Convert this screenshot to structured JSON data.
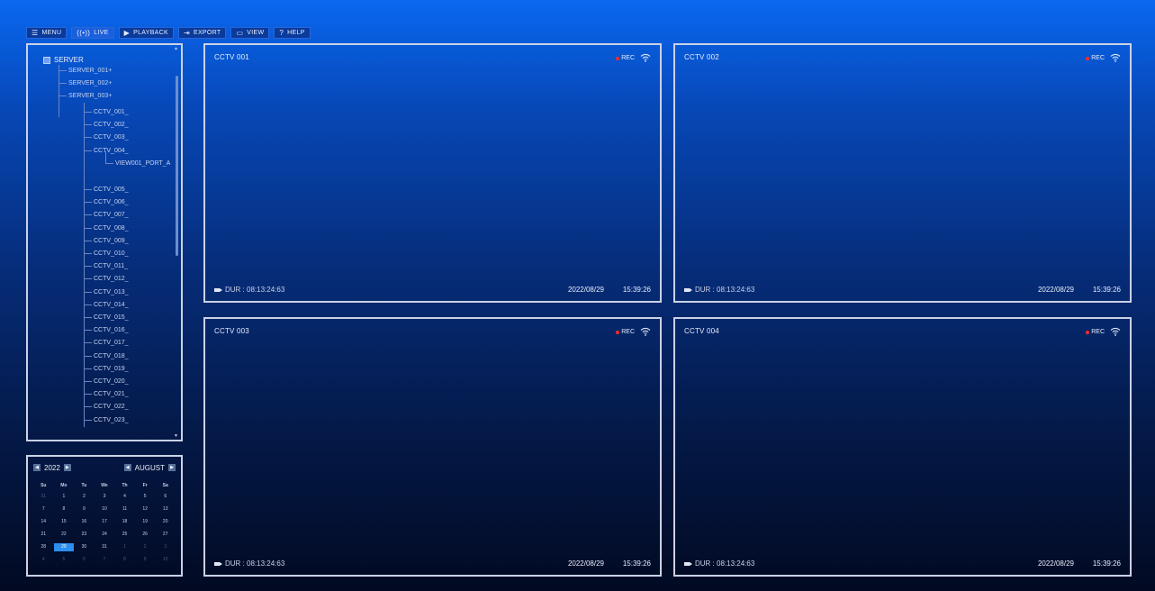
{
  "nav": [
    {
      "icon": "☰",
      "label": "MENU",
      "active": false
    },
    {
      "icon": "((•))",
      "label": "LIVE",
      "active": true
    },
    {
      "icon": "▶",
      "label": "PLAYBACK",
      "active": false
    },
    {
      "icon": "⇥",
      "label": "EXPORT",
      "active": false
    },
    {
      "icon": "▭",
      "label": "VIEW",
      "active": false
    },
    {
      "icon": "?",
      "label": "HELP",
      "active": false
    }
  ],
  "tree": {
    "root": "SERVER",
    "servers": [
      "SERVER_001+",
      "SERVER_002+",
      "SERVER_003+"
    ],
    "cameras_before": [
      "CCTV_001_",
      "CCTV_002_",
      "CCTV_003_",
      "CCTV_004_"
    ],
    "port": "VIEW001_PORT_A",
    "cameras_after": [
      "CCTV_005_",
      "CCTV_006_",
      "CCTV_007_",
      "CCTV_008_",
      "CCTV_009_",
      "CCTV_010_",
      "CCTV_011_",
      "CCTV_012_",
      "CCTV_013_",
      "CCTV_014_",
      "CCTV_015_",
      "CCTV_016_",
      "CCTV_017_",
      "CCTV_018_",
      "CCTV_019_",
      "CCTV_020_",
      "CCTV_021_",
      "CCTV_022_",
      "CCTV_023_"
    ]
  },
  "calendar": {
    "year": "2022",
    "month": "AUGUST",
    "weekdays": [
      "Su",
      "Mo",
      "Tu",
      "We",
      "Th",
      "Fr",
      "Sa"
    ],
    "days": [
      {
        "d": "31",
        "m": true
      },
      {
        "d": "1"
      },
      {
        "d": "2"
      },
      {
        "d": "3"
      },
      {
        "d": "4"
      },
      {
        "d": "5"
      },
      {
        "d": "6"
      },
      {
        "d": "7"
      },
      {
        "d": "8"
      },
      {
        "d": "9"
      },
      {
        "d": "10"
      },
      {
        "d": "11"
      },
      {
        "d": "12"
      },
      {
        "d": "13"
      },
      {
        "d": "14"
      },
      {
        "d": "15"
      },
      {
        "d": "16"
      },
      {
        "d": "17"
      },
      {
        "d": "18"
      },
      {
        "d": "19"
      },
      {
        "d": "20"
      },
      {
        "d": "21"
      },
      {
        "d": "22"
      },
      {
        "d": "23"
      },
      {
        "d": "24"
      },
      {
        "d": "25"
      },
      {
        "d": "26"
      },
      {
        "d": "27"
      },
      {
        "d": "28"
      },
      {
        "d": "29",
        "s": true
      },
      {
        "d": "30"
      },
      {
        "d": "31"
      },
      {
        "d": "1",
        "m": true
      },
      {
        "d": "2",
        "m": true
      },
      {
        "d": "3",
        "m": true
      },
      {
        "d": "4",
        "m": true
      },
      {
        "d": "5",
        "m": true
      },
      {
        "d": "6",
        "m": true
      },
      {
        "d": "7",
        "m": true
      },
      {
        "d": "8",
        "m": true
      },
      {
        "d": "9",
        "m": true
      },
      {
        "d": "10",
        "m": true
      }
    ]
  },
  "cameras": [
    {
      "title": "CCTV 001",
      "rec": "REC",
      "dur": "DUR : 08:13:24:63",
      "date": "2022/08/29",
      "time": "15:39:26"
    },
    {
      "title": "CCTV 002",
      "rec": "REC",
      "dur": "DUR : 08:13:24:63",
      "date": "2022/08/29",
      "time": "15:39:26"
    },
    {
      "title": "CCTV 003",
      "rec": "REC",
      "dur": "DUR : 08:13:24:63",
      "date": "2022/08/29",
      "time": "15:39:26"
    },
    {
      "title": "CCTV 004",
      "rec": "REC",
      "dur": "DUR : 08:13:24:63",
      "date": "2022/08/29",
      "time": "15:39:26"
    }
  ],
  "colors": {
    "accent": "#1a5fdc",
    "rec_dot": "#ff2a2a",
    "selected_day": "#2b8ef0"
  }
}
